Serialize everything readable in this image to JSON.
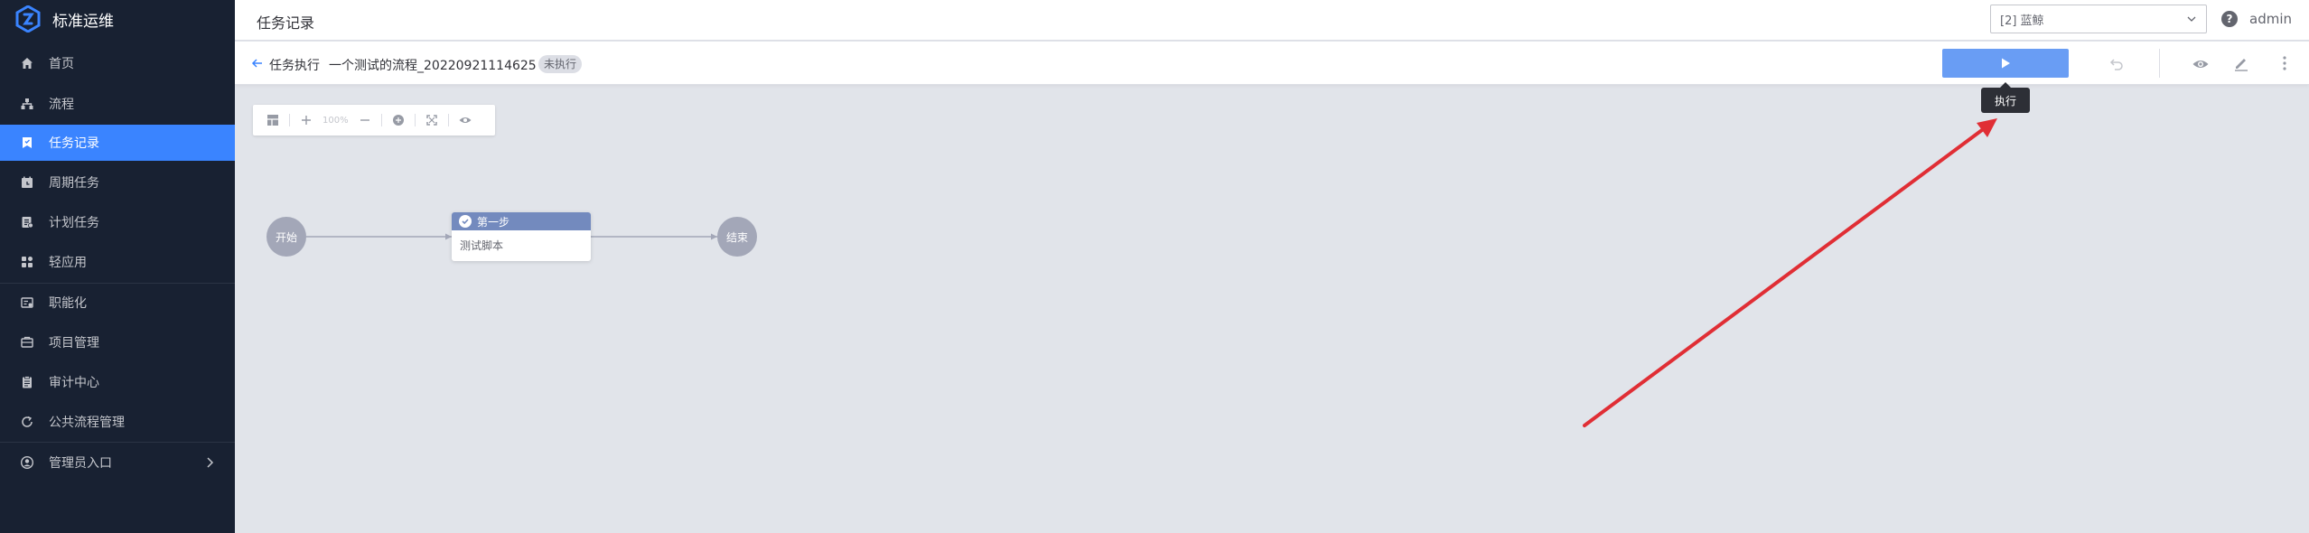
{
  "app": {
    "title": "标准运维"
  },
  "sidebar": {
    "items": [
      {
        "label": "首页",
        "icon": "home-icon"
      },
      {
        "label": "流程",
        "icon": "sitemap-icon"
      },
      {
        "label": "任务记录",
        "icon": "bookmark-icon",
        "active": true
      },
      {
        "label": "周期任务",
        "icon": "calendar-icon"
      },
      {
        "label": "计划任务",
        "icon": "plan-icon"
      },
      {
        "label": "轻应用",
        "icon": "apps-icon"
      },
      {
        "label": "职能化",
        "icon": "function-icon"
      },
      {
        "label": "项目管理",
        "icon": "project-icon"
      },
      {
        "label": "审计中心",
        "icon": "audit-icon"
      },
      {
        "label": "公共流程管理",
        "icon": "refresh-icon"
      },
      {
        "label": "管理员入口",
        "icon": "user-circle-icon"
      }
    ]
  },
  "header": {
    "page_title": "任务记录",
    "business_select": "[2] 蓝鲸",
    "help": "?",
    "user": "admin"
  },
  "subheader": {
    "crumb": "任务执行",
    "task_name": "一个测试的流程_20220921114625",
    "status": "未执行",
    "tooltip": "执行"
  },
  "canvas_toolbar": {
    "zoom": "100%"
  },
  "flow": {
    "start_label": "开始",
    "end_label": "结束",
    "node_title": "第一步",
    "node_body": "测试脚本"
  },
  "colors": {
    "accent": "#3a84ff",
    "sidebar_bg": "#182132",
    "annotation_arrow": "#e02e35"
  }
}
